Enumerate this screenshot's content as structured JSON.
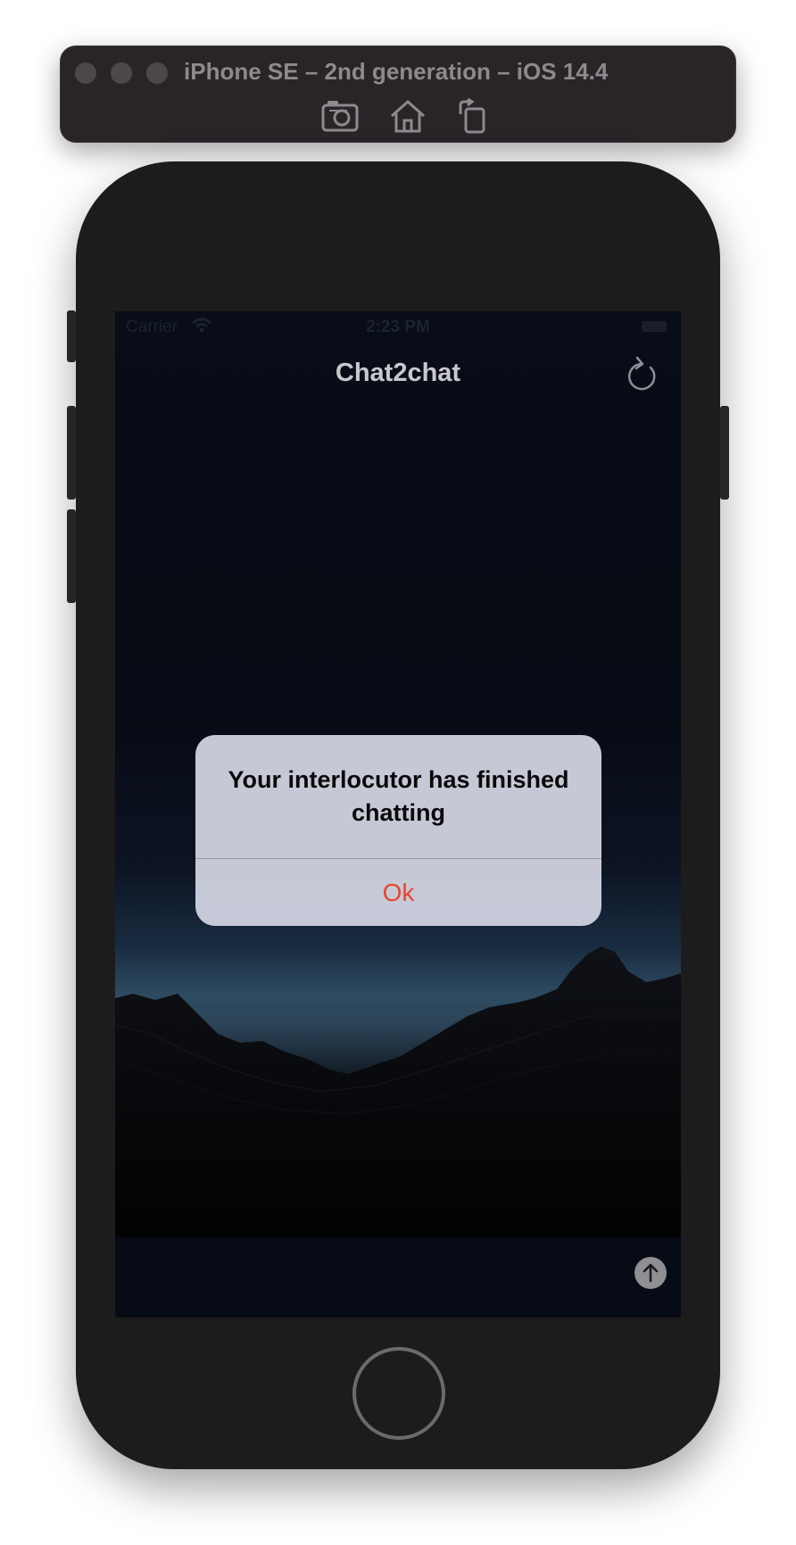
{
  "simulator": {
    "title": "iPhone SE – 2nd generation – iOS 14.4",
    "toolbar_icons": [
      "screenshot-icon",
      "home-icon",
      "rotate-icon"
    ]
  },
  "status_bar": {
    "carrier": "Carrier",
    "time": "2:23 PM"
  },
  "nav": {
    "title": "Chat2chat",
    "refresh_icon": "refresh-icon"
  },
  "alert": {
    "title": "Your interlocutor has finished chatting",
    "ok_label": "Ok"
  },
  "input_bar": {
    "send_icon": "arrow-up-icon"
  },
  "colors": {
    "alert_action": "#e8452f",
    "toolbar_bg": "#2a2429",
    "phone_body": "#1c1c1c"
  }
}
